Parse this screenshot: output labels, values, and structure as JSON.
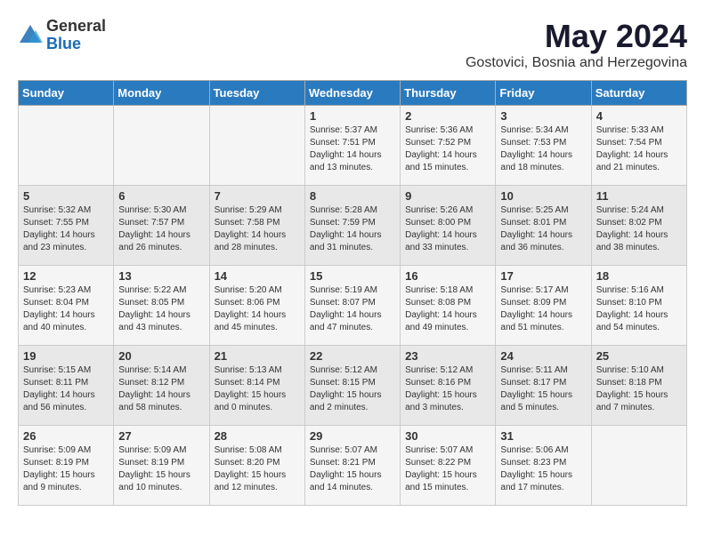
{
  "logo": {
    "general": "General",
    "blue": "Blue"
  },
  "title": "May 2024",
  "location": "Gostovici, Bosnia and Herzegovina",
  "weekdays": [
    "Sunday",
    "Monday",
    "Tuesday",
    "Wednesday",
    "Thursday",
    "Friday",
    "Saturday"
  ],
  "weeks": [
    [
      {
        "day": "",
        "info": ""
      },
      {
        "day": "",
        "info": ""
      },
      {
        "day": "",
        "info": ""
      },
      {
        "day": "1",
        "info": "Sunrise: 5:37 AM\nSunset: 7:51 PM\nDaylight: 14 hours\nand 13 minutes."
      },
      {
        "day": "2",
        "info": "Sunrise: 5:36 AM\nSunset: 7:52 PM\nDaylight: 14 hours\nand 15 minutes."
      },
      {
        "day": "3",
        "info": "Sunrise: 5:34 AM\nSunset: 7:53 PM\nDaylight: 14 hours\nand 18 minutes."
      },
      {
        "day": "4",
        "info": "Sunrise: 5:33 AM\nSunset: 7:54 PM\nDaylight: 14 hours\nand 21 minutes."
      }
    ],
    [
      {
        "day": "5",
        "info": "Sunrise: 5:32 AM\nSunset: 7:55 PM\nDaylight: 14 hours\nand 23 minutes."
      },
      {
        "day": "6",
        "info": "Sunrise: 5:30 AM\nSunset: 7:57 PM\nDaylight: 14 hours\nand 26 minutes."
      },
      {
        "day": "7",
        "info": "Sunrise: 5:29 AM\nSunset: 7:58 PM\nDaylight: 14 hours\nand 28 minutes."
      },
      {
        "day": "8",
        "info": "Sunrise: 5:28 AM\nSunset: 7:59 PM\nDaylight: 14 hours\nand 31 minutes."
      },
      {
        "day": "9",
        "info": "Sunrise: 5:26 AM\nSunset: 8:00 PM\nDaylight: 14 hours\nand 33 minutes."
      },
      {
        "day": "10",
        "info": "Sunrise: 5:25 AM\nSunset: 8:01 PM\nDaylight: 14 hours\nand 36 minutes."
      },
      {
        "day": "11",
        "info": "Sunrise: 5:24 AM\nSunset: 8:02 PM\nDaylight: 14 hours\nand 38 minutes."
      }
    ],
    [
      {
        "day": "12",
        "info": "Sunrise: 5:23 AM\nSunset: 8:04 PM\nDaylight: 14 hours\nand 40 minutes."
      },
      {
        "day": "13",
        "info": "Sunrise: 5:22 AM\nSunset: 8:05 PM\nDaylight: 14 hours\nand 43 minutes."
      },
      {
        "day": "14",
        "info": "Sunrise: 5:20 AM\nSunset: 8:06 PM\nDaylight: 14 hours\nand 45 minutes."
      },
      {
        "day": "15",
        "info": "Sunrise: 5:19 AM\nSunset: 8:07 PM\nDaylight: 14 hours\nand 47 minutes."
      },
      {
        "day": "16",
        "info": "Sunrise: 5:18 AM\nSunset: 8:08 PM\nDaylight: 14 hours\nand 49 minutes."
      },
      {
        "day": "17",
        "info": "Sunrise: 5:17 AM\nSunset: 8:09 PM\nDaylight: 14 hours\nand 51 minutes."
      },
      {
        "day": "18",
        "info": "Sunrise: 5:16 AM\nSunset: 8:10 PM\nDaylight: 14 hours\nand 54 minutes."
      }
    ],
    [
      {
        "day": "19",
        "info": "Sunrise: 5:15 AM\nSunset: 8:11 PM\nDaylight: 14 hours\nand 56 minutes."
      },
      {
        "day": "20",
        "info": "Sunrise: 5:14 AM\nSunset: 8:12 PM\nDaylight: 14 hours\nand 58 minutes."
      },
      {
        "day": "21",
        "info": "Sunrise: 5:13 AM\nSunset: 8:14 PM\nDaylight: 15 hours\nand 0 minutes."
      },
      {
        "day": "22",
        "info": "Sunrise: 5:12 AM\nSunset: 8:15 PM\nDaylight: 15 hours\nand 2 minutes."
      },
      {
        "day": "23",
        "info": "Sunrise: 5:12 AM\nSunset: 8:16 PM\nDaylight: 15 hours\nand 3 minutes."
      },
      {
        "day": "24",
        "info": "Sunrise: 5:11 AM\nSunset: 8:17 PM\nDaylight: 15 hours\nand 5 minutes."
      },
      {
        "day": "25",
        "info": "Sunrise: 5:10 AM\nSunset: 8:18 PM\nDaylight: 15 hours\nand 7 minutes."
      }
    ],
    [
      {
        "day": "26",
        "info": "Sunrise: 5:09 AM\nSunset: 8:19 PM\nDaylight: 15 hours\nand 9 minutes."
      },
      {
        "day": "27",
        "info": "Sunrise: 5:09 AM\nSunset: 8:19 PM\nDaylight: 15 hours\nand 10 minutes."
      },
      {
        "day": "28",
        "info": "Sunrise: 5:08 AM\nSunset: 8:20 PM\nDaylight: 15 hours\nand 12 minutes."
      },
      {
        "day": "29",
        "info": "Sunrise: 5:07 AM\nSunset: 8:21 PM\nDaylight: 15 hours\nand 14 minutes."
      },
      {
        "day": "30",
        "info": "Sunrise: 5:07 AM\nSunset: 8:22 PM\nDaylight: 15 hours\nand 15 minutes."
      },
      {
        "day": "31",
        "info": "Sunrise: 5:06 AM\nSunset: 8:23 PM\nDaylight: 15 hours\nand 17 minutes."
      },
      {
        "day": "",
        "info": ""
      }
    ]
  ]
}
